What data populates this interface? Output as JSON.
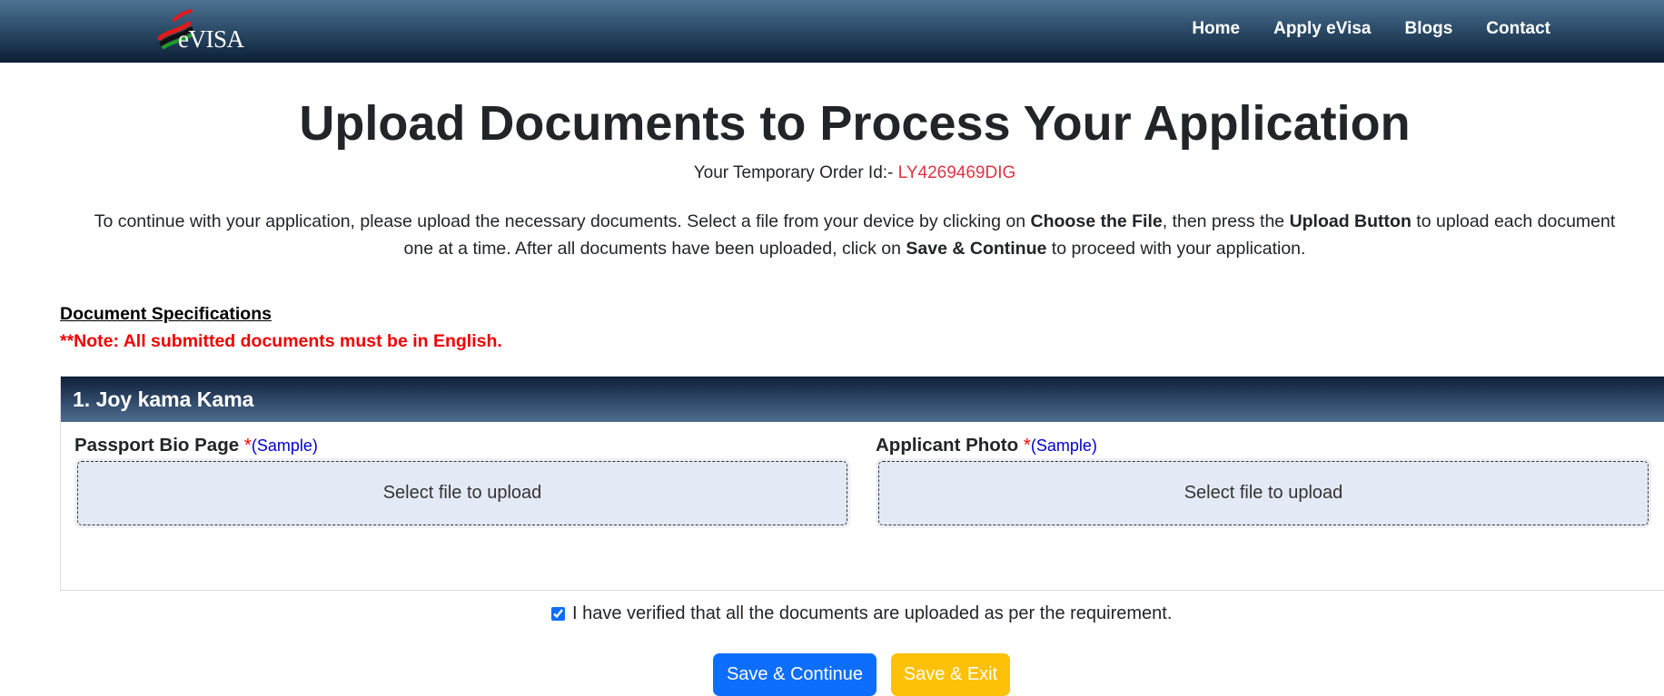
{
  "nav": {
    "logo_text": "eVISA",
    "links": [
      "Home",
      "Apply eVisa",
      "Blogs",
      "Contact"
    ]
  },
  "page": {
    "title": "Upload Documents to Process Your Application",
    "order_label": "Your Temporary Order Id:- ",
    "order_id": "LY4269469DIG",
    "intro": {
      "part1": "To continue with your application, please upload the necessary documents. Select a file from your device by clicking on ",
      "bold1": "Choose the File",
      "part2": ", then press the ",
      "bold2": "Upload Button",
      "part3": " to upload each document one at a time. After all documents have been uploaded, click on ",
      "bold3": "Save & Continue",
      "part4": " to proceed with your application."
    }
  },
  "specs": {
    "title": "Document Specifications",
    "note": "**Note: All submitted documents must be in English."
  },
  "applicant": {
    "header": "1. Joy kama Kama",
    "fields": [
      {
        "label": "Passport Bio Page ",
        "required": "*",
        "sample": "(Sample)",
        "dropzone": "Select file to upload"
      },
      {
        "label": "Applicant Photo ",
        "required": "*",
        "sample": "(Sample)",
        "dropzone": "Select file to upload"
      }
    ]
  },
  "verify": {
    "checked": true,
    "label": "I have verified that all the documents are uploaded as per the requirement."
  },
  "buttons": {
    "save_continue": "Save & Continue",
    "save_exit": "Save & Exit"
  },
  "colors": {
    "navbar": "#2d4d6a",
    "order_id": "#dc3545",
    "note": "#f00000",
    "primary": "#0d6efd",
    "warning": "#ffc107",
    "dropzone": "#e4e9f6"
  }
}
